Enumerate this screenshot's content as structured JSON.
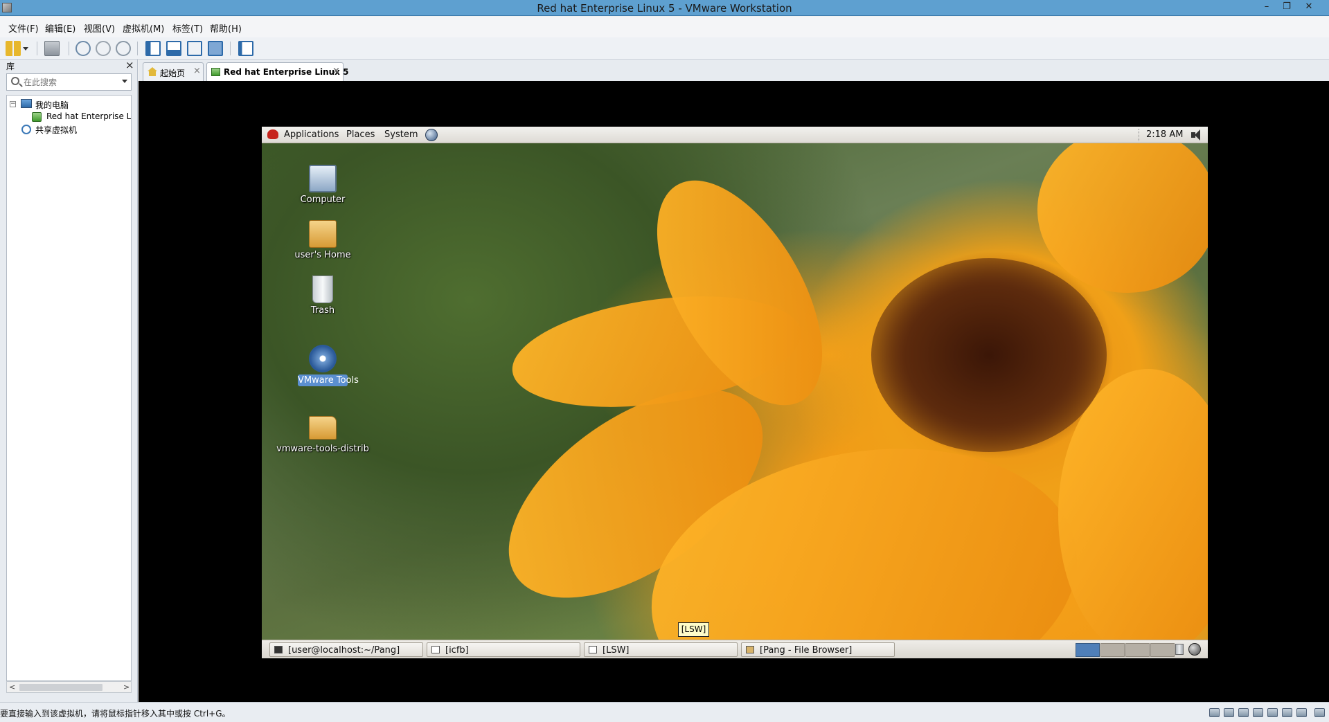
{
  "window": {
    "title": "Red hat Enterprise Linux 5 - VMware Workstation",
    "minimize": "–",
    "restore": "❐",
    "close": "✕"
  },
  "menubar": {
    "items": [
      "文件(F)",
      "编辑(E)",
      "视图(V)",
      "虚拟机(M)",
      "标签(T)",
      "帮助(H)"
    ]
  },
  "library": {
    "title": "库",
    "close": "×",
    "search_placeholder": "在此搜索",
    "tree": {
      "my_computer": "我的电脑",
      "vm_item": "Red hat Enterprise L",
      "shared": "共享虚拟机",
      "expander": "−"
    },
    "scroll_left": "<",
    "scroll_right": ">"
  },
  "tabs": [
    {
      "label": "起始页",
      "close": "×"
    },
    {
      "label": "Red hat Enterprise Linux 5",
      "close": "×"
    }
  ],
  "guest": {
    "top_panel": {
      "menus": [
        "Applications",
        "Places",
        "System"
      ],
      "clock": "2:18 AM"
    },
    "desktop_icons": [
      {
        "label": "Computer"
      },
      {
        "label": "user's Home"
      },
      {
        "label": "Trash"
      },
      {
        "label": "VMware Tools",
        "selected": true
      },
      {
        "label": "vmware-tools-distrib"
      }
    ],
    "tooltip": "[LSW]",
    "taskbar": [
      "[user@localhost:~/Pang]",
      "[icfb]",
      "[LSW]",
      "[Pang - File Browser]"
    ],
    "workspaces_active": 1
  },
  "statusbar": {
    "message": "要直接输入到该虚拟机，请将鼠标指针移入其中或按 Ctrl+G。"
  },
  "colors": {
    "titlebar": "#5ea0d0",
    "selection": "#5b8fd0",
    "workspace_active": "#4f7fb8"
  }
}
